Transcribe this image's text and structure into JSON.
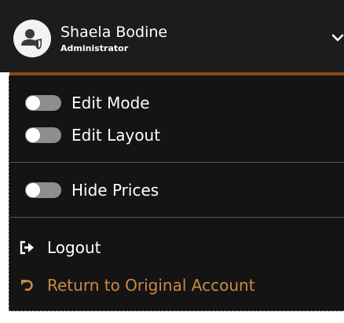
{
  "user": {
    "name": "Shaela Bodine",
    "role": "Administrator"
  },
  "menu": {
    "toggles": [
      {
        "label": "Edit Mode",
        "on": false
      },
      {
        "label": "Edit Layout",
        "on": false
      },
      {
        "label": "Hide Prices",
        "on": false
      }
    ],
    "logout_label": "Logout",
    "return_label": "Return to Original Account"
  },
  "icons": {
    "avatar": "user-shield-icon",
    "chevron": "chevron-down-icon",
    "logout": "sign-out-icon",
    "return": "undo-icon"
  },
  "colors": {
    "header_bg": "#1c1c1c",
    "panel_bg": "#141414",
    "accent": "#8a4a12",
    "return_link": "#c98a44",
    "toggle_off": "#8e8e8e"
  }
}
